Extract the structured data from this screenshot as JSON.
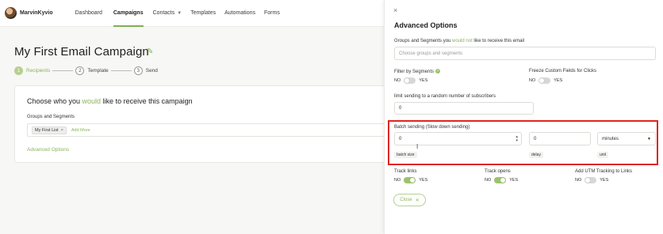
{
  "nav": {
    "username": "MarvinKyvio",
    "items": [
      {
        "label": "Dashboard"
      },
      {
        "label": "Campaigns"
      },
      {
        "label": "Contacts"
      },
      {
        "label": "Templates"
      },
      {
        "label": "Automations"
      },
      {
        "label": "Forms"
      }
    ]
  },
  "campaign": {
    "title": "My First Email Campaign",
    "steps": [
      {
        "num": "1",
        "label": "Recipients"
      },
      {
        "num": "2",
        "label": "Template"
      },
      {
        "num": "3",
        "label": "Send"
      }
    ],
    "card": {
      "title_pre": "Choose who you ",
      "title_hl": "would",
      "title_post": " like to receive this campaign",
      "groups_label": "Groups and Segments",
      "tag": "My First List",
      "tag_remove": "×",
      "add_more": "Add More",
      "advanced_link": "Advanced Options"
    }
  },
  "panel": {
    "close_icon": "×",
    "title": "Advanced Options",
    "exclude": {
      "label_pre": "Groups and Segments you ",
      "label_hl": "would not",
      "label_post": " like to receive this email",
      "placeholder": "Choose groups and segments"
    },
    "filter_segments": {
      "label": "Filter by Segments",
      "no": "NO",
      "yes": "YES",
      "on": false
    },
    "freeze_fields": {
      "label": "Freeze Custom Fields for Clicks",
      "no": "NO",
      "yes": "YES",
      "on": false
    },
    "limit": {
      "label": "limit sending to a random number of subscribers",
      "value": "0"
    },
    "batch": {
      "label": "Batch sending (Slow down sending)",
      "size_value": "0",
      "delay_value": "0",
      "unit_value": "minutes",
      "size_label": "batch size",
      "delay_label": "delay",
      "unit_label": "unit"
    },
    "track_links": {
      "label": "Track links",
      "no": "NO",
      "yes": "YES",
      "on": true
    },
    "track_opens": {
      "label": "Track opens",
      "no": "NO",
      "yes": "YES",
      "on": true
    },
    "utm": {
      "label": "Add UTM Tracking to Links",
      "no": "NO",
      "yes": "YES",
      "on": false
    },
    "close_button": "Close",
    "close_button_icon": "✕"
  },
  "colors": {
    "accent": "#8cb35c",
    "highlight": "#e0261c"
  }
}
